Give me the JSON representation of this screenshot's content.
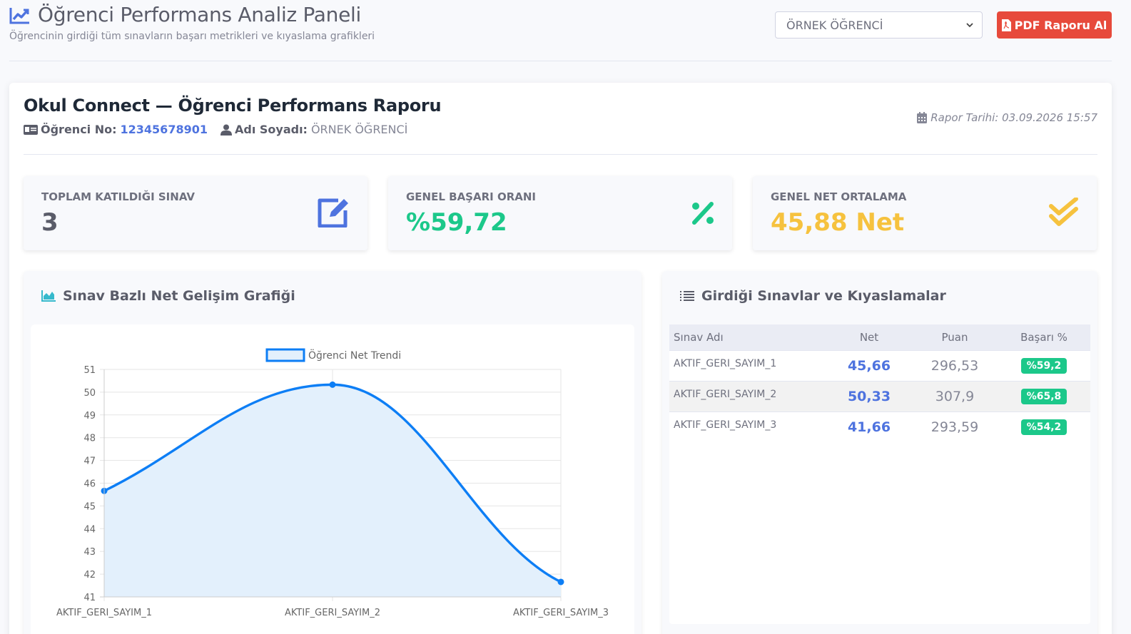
{
  "header": {
    "title": "Öğrenci Performans Analiz Paneli",
    "subtitle": "Öğrencinin girdiği tüm sınavların başarı metrikleri ve kıyaslama grafikleri",
    "student_select_value": "ÖRNEK ÖĞRENCİ",
    "pdf_button_label": "PDF Raporu Al"
  },
  "report": {
    "title": "Okul Connect — Öğrenci Performans Raporu",
    "student_no_label": "Öğrenci No:",
    "student_no": "12345678901",
    "name_label": "Adı Soyadı:",
    "name": "ÖRNEK ÖĞRENCİ",
    "date_text": "Rapor Tarihi: 03.09.2026 15:57"
  },
  "stats": [
    {
      "label": "TOPLAM KATILDIĞI SINAV",
      "value": "3",
      "color": "#5a5c69",
      "icon": "edit-icon"
    },
    {
      "label": "GENEL BAŞARI ORANI",
      "value": "%59,72",
      "color": "#1cc88a",
      "icon": "percent-icon"
    },
    {
      "label": "GENEL NET ORTALAMA",
      "value": "45,88 Net",
      "color": "#f6c23e",
      "icon": "double-check-icon"
    }
  ],
  "chart_panel": {
    "title": "Sınav Bazlı Net Gelişim Grafiği"
  },
  "table_panel": {
    "title": "Girdiği Sınavlar ve Kıyaslamalar",
    "headers": [
      "Sınav Adı",
      "Net",
      "Puan",
      "Başarı %"
    ],
    "rows": [
      {
        "name": "AKTIF_GERI_SAYIM_1",
        "net": "45,66",
        "puan": "296,53",
        "basari": "%59,2"
      },
      {
        "name": "AKTIF_GERI_SAYIM_2",
        "net": "50,33",
        "puan": "307,9",
        "basari": "%65,8"
      },
      {
        "name": "AKTIF_GERI_SAYIM_3",
        "net": "41,66",
        "puan": "293,59",
        "basari": "%54,2"
      }
    ]
  },
  "chart_data": {
    "type": "line",
    "categories": [
      "AKTIF_GERI_SAYIM_1",
      "AKTIF_GERI_SAYIM_2",
      "AKTIF_GERI_SAYIM_3"
    ],
    "series": [
      {
        "name": "Öğrenci Net Trendi",
        "values": [
          45.66,
          50.33,
          41.66
        ]
      }
    ],
    "y_ticks": [
      41,
      42,
      43,
      44,
      45,
      46,
      47,
      48,
      49,
      50,
      51
    ],
    "ylim": [
      41,
      51
    ],
    "grid": true,
    "filled": true,
    "legend_position": "top",
    "line_color": "#0d7ef5",
    "fill_color": "#e3f0fc"
  },
  "colors": {
    "primary": "#4e73df",
    "danger": "#e74a3b",
    "success": "#1cc88a",
    "warning": "#f6c23e"
  }
}
